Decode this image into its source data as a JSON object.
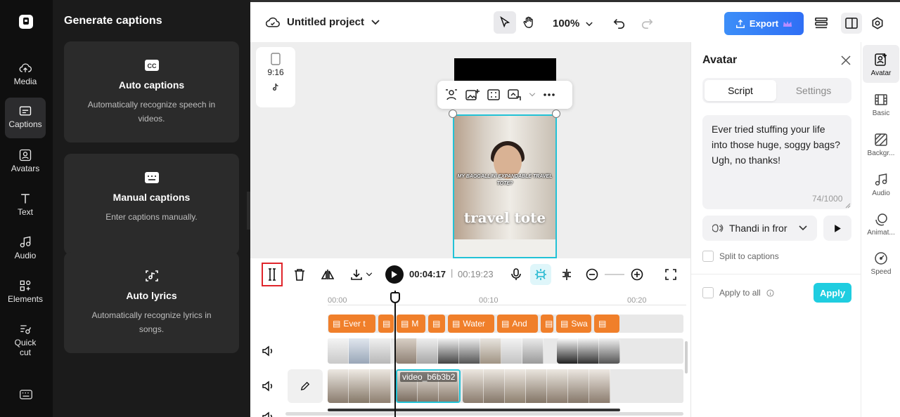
{
  "left_rail": {
    "items": [
      {
        "label": "Media",
        "icon": "cloud-upload-icon"
      },
      {
        "label": "Captions",
        "icon": "captions-icon",
        "active": true
      },
      {
        "label": "Avatars",
        "icon": "avatar-icon"
      },
      {
        "label": "Text",
        "icon": "text-icon"
      },
      {
        "label": "Audio",
        "icon": "music-icon"
      },
      {
        "label": "Elements",
        "icon": "elements-icon"
      },
      {
        "label": "Quick cut",
        "icon": "quick-cut-icon"
      }
    ]
  },
  "captions_panel": {
    "title": "Generate captions",
    "cards": [
      {
        "title": "Auto captions",
        "desc": "Automatically recognize speech in videos.",
        "icon": "cc-icon"
      },
      {
        "title": "Manual captions",
        "desc": "Enter captions manually.",
        "icon": "keyboard-icon"
      },
      {
        "title": "Auto lyrics",
        "desc": "Automatically recognize lyrics in songs.",
        "icon": "lyrics-icon"
      }
    ]
  },
  "topbar": {
    "project_name": "Untitled project",
    "zoom": "100%",
    "export_label": "Export"
  },
  "canvas": {
    "ratio_label": "9:16",
    "caption_small": "MY BAGGALLINI EXPANDABLE TRAVEL TOTE?",
    "caption_large": "travel tote"
  },
  "timeline": {
    "current_time": "00:04:17",
    "separator": "|",
    "total_time": "00:19:23",
    "ruler": [
      "00:00",
      "00:10",
      "00:20"
    ],
    "caption_chips": [
      "Ever t",
      "",
      "M",
      "",
      "Water",
      "And",
      "",
      "Swa",
      ""
    ],
    "clip_name": "video_b6b3b2"
  },
  "avatar_panel": {
    "title": "Avatar",
    "tabs": [
      "Script",
      "Settings"
    ],
    "script": "Ever tried stuffing your life into those huge, soggy bags? Ugh, no thanks!",
    "char_count": "74/1000",
    "voice": "Thandi in fror",
    "split_label": "Split to captions",
    "apply_all_label": "Apply to all",
    "apply_label": "Apply"
  },
  "right_rail": {
    "items": [
      {
        "label": "Avatar",
        "active": true
      },
      {
        "label": "Basic"
      },
      {
        "label": "Backgr..."
      },
      {
        "label": "Audio"
      },
      {
        "label": "Animat..."
      },
      {
        "label": "Speed"
      }
    ]
  },
  "colors": {
    "accent": "#1fcde0",
    "export": "#2f6ff5",
    "caption_chip": "#f07f2a",
    "selection": "#e0252b"
  }
}
